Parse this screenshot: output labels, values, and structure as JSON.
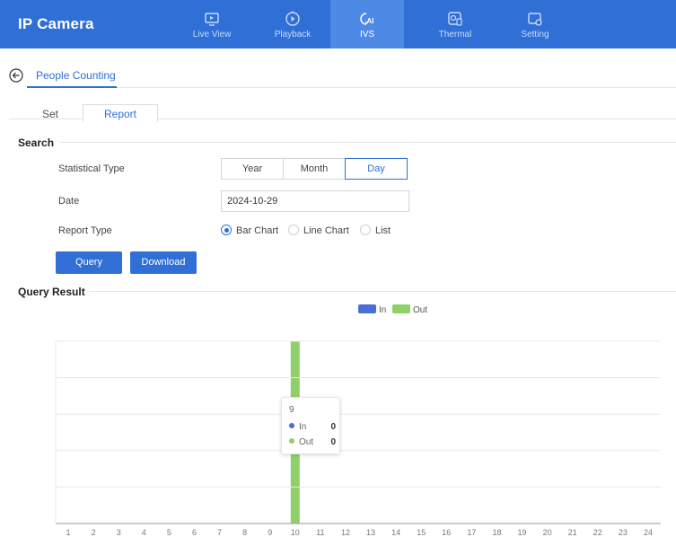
{
  "app": {
    "title": "IP Camera"
  },
  "nav": [
    {
      "label": "Live View",
      "icon": "live-view-icon",
      "active": false
    },
    {
      "label": "Playback",
      "icon": "playback-icon",
      "active": false
    },
    {
      "label": "IVS",
      "icon": "ai-icon",
      "active": true
    },
    {
      "label": "Thermal",
      "icon": "thermal-icon",
      "active": false
    },
    {
      "label": "Setting",
      "icon": "setting-icon",
      "active": false
    }
  ],
  "page": {
    "title": "People Counting"
  },
  "subtabs": {
    "set": "Set",
    "report": "Report",
    "active": "Report"
  },
  "search": {
    "header": "Search",
    "statistical_type": {
      "label": "Statistical Type",
      "options": [
        "Year",
        "Month",
        "Day"
      ],
      "selected": "Day"
    },
    "date": {
      "label": "Date",
      "value": "2024-10-29"
    },
    "report_type": {
      "label": "Report Type",
      "options": [
        "Bar Chart",
        "Line Chart",
        "List"
      ],
      "selected": "Bar Chart"
    },
    "query_label": "Query",
    "download_label": "Download"
  },
  "result": {
    "header": "Query Result"
  },
  "colors": {
    "in": "#4a6fd4",
    "out": "#8fd06a",
    "accent": "#2f6fd6"
  },
  "chart_data": {
    "type": "bar",
    "categories": [
      "1",
      "2",
      "3",
      "4",
      "5",
      "6",
      "7",
      "8",
      "9",
      "10",
      "11",
      "12",
      "13",
      "14",
      "15",
      "16",
      "17",
      "18",
      "19",
      "20",
      "21",
      "22",
      "23",
      "24"
    ],
    "series": [
      {
        "name": "In",
        "values": [
          0,
          0,
          0,
          0,
          0,
          0,
          0,
          0,
          0,
          0,
          0,
          0,
          0,
          0,
          0,
          0,
          0,
          0,
          0,
          0,
          0,
          0,
          0,
          0
        ]
      },
      {
        "name": "Out",
        "values": [
          0,
          0,
          0,
          0,
          0,
          0,
          0,
          0,
          0,
          0,
          0,
          0,
          0,
          0,
          0,
          0,
          0,
          0,
          0,
          0,
          0,
          0,
          0,
          0
        ]
      }
    ],
    "highlighted_category": "10",
    "grid": true,
    "legend": "top-center",
    "tooltip": {
      "title": "9",
      "rows": [
        {
          "name": "In",
          "value": "0"
        },
        {
          "name": "Out",
          "value": "0"
        }
      ]
    }
  }
}
